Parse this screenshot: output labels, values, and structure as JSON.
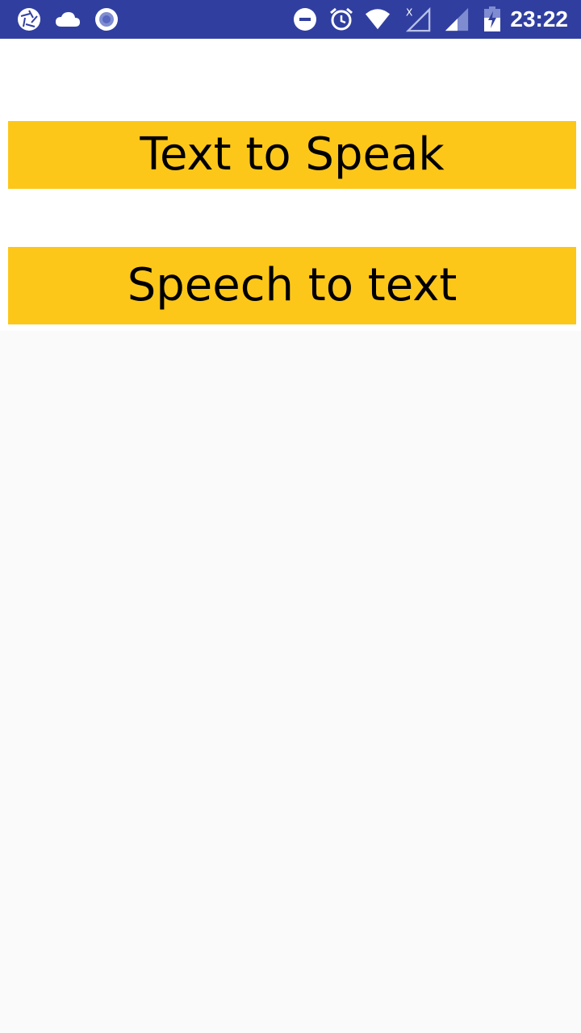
{
  "status_bar": {
    "background": "#303f9f",
    "left_icons": [
      "aperture-icon",
      "cloud-icon",
      "radio-record-icon"
    ],
    "right_icons": [
      "do-not-disturb-icon",
      "alarm-clock-icon",
      "wifi-icon",
      "mobile-data-off-icon",
      "signal-icon",
      "battery-charging-icon"
    ],
    "time": "23:22"
  },
  "main": {
    "accent_color": "#fdc719",
    "buttons": [
      {
        "label": "Text to Speak"
      },
      {
        "label": "Speech to text"
      }
    ]
  }
}
